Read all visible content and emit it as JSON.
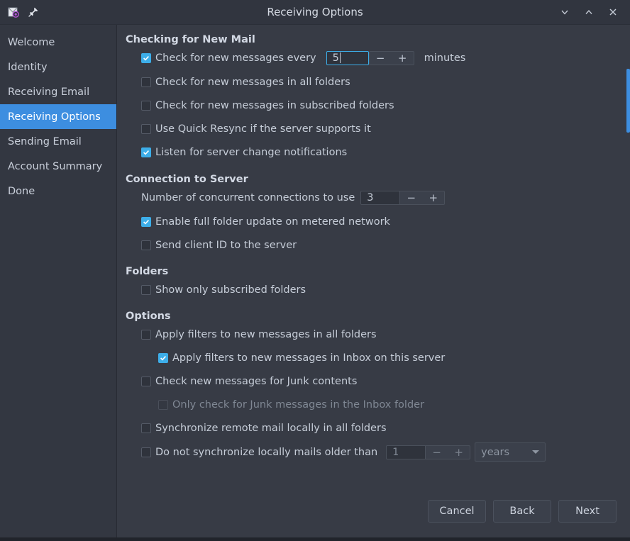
{
  "titlebar": {
    "title": "Receiving Options",
    "app_icon": "mail-envelope-icon",
    "pin_icon": "pin-icon",
    "minimize_label": "⌄",
    "maximize_label": "⌃",
    "close_label": "×"
  },
  "sidebar": {
    "items": [
      {
        "label": "Welcome",
        "selected": false
      },
      {
        "label": "Identity",
        "selected": false
      },
      {
        "label": "Receiving Email",
        "selected": false
      },
      {
        "label": "Receiving Options",
        "selected": true
      },
      {
        "label": "Sending Email",
        "selected": false
      },
      {
        "label": "Account Summary",
        "selected": false
      },
      {
        "label": "Done",
        "selected": false
      }
    ]
  },
  "sections": {
    "checking": {
      "title": "Checking for New Mail",
      "check_every_label": "Check for new messages every",
      "check_every_value": "5",
      "minutes_label": "minutes",
      "all_folders_label": "Check for new messages in all folders",
      "subscribed_folders_label": "Check for new messages in subscribed folders",
      "quick_resync_label": "Use Quick Resync if the server supports it",
      "listen_label": "Listen for server change notifications"
    },
    "connection": {
      "title": "Connection to Server",
      "concurrent_label": "Number of concurrent connections to use",
      "concurrent_value": "3",
      "metered_label": "Enable full folder update on metered network",
      "client_id_label": "Send client ID to the server"
    },
    "folders": {
      "title": "Folders",
      "subscribed_only_label": "Show only subscribed folders"
    },
    "options": {
      "title": "Options",
      "filters_all_label": "Apply filters to new messages in all folders",
      "filters_inbox_label": "Apply filters to new messages in Inbox on this server",
      "junk_label": "Check new messages for Junk contents",
      "junk_inbox_label": "Only check for Junk messages in the Inbox folder",
      "sync_remote_label": "Synchronize remote mail locally in all folders",
      "no_sync_older_label": "Do not synchronize locally mails older than",
      "no_sync_value": "1",
      "no_sync_unit": "years"
    }
  },
  "spinner": {
    "decrement_label": "−",
    "increment_label": "+"
  },
  "footer": {
    "cancel_label": "Cancel",
    "back_label": "Back",
    "next_label": "Next"
  },
  "colors": {
    "accent": "#3daee9",
    "selection": "#3d8ee0",
    "window_bg": "#373b45",
    "sidebar_bg": "#333741",
    "titlebar_bg": "#31353f"
  }
}
